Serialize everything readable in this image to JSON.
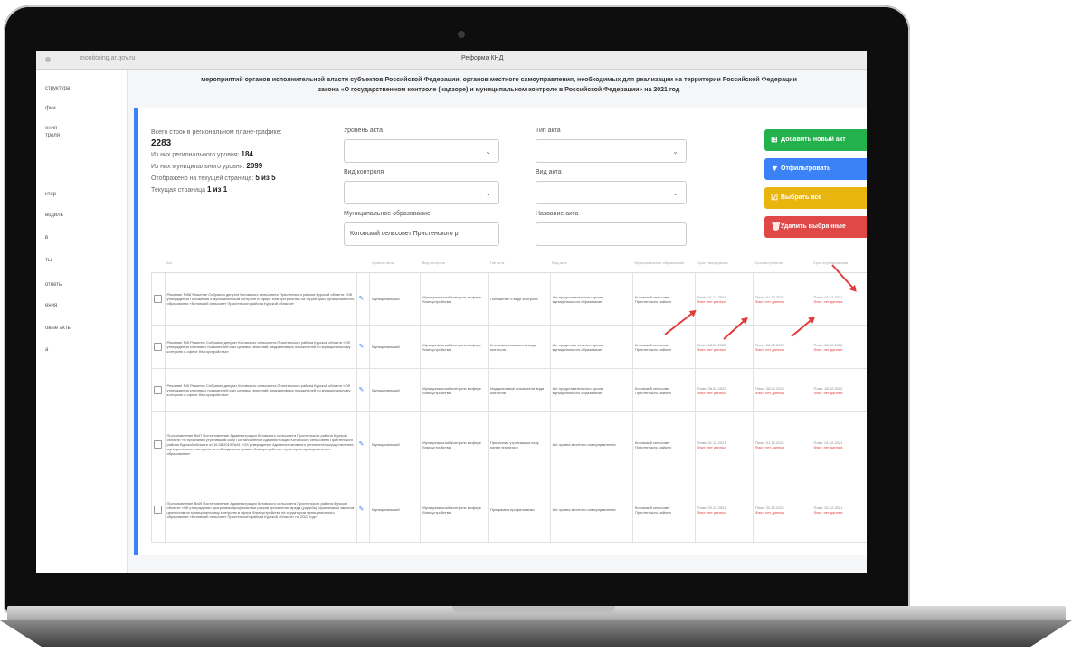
{
  "window": {
    "url": "monitoring.ar.gov.ru",
    "title": "Реформа КНД"
  },
  "sidebar": {
    "items": [
      "структура",
      "фии",
      "ения",
      "троля",
      "ктор",
      "водиль",
      "в",
      "ты",
      "ответы",
      "ения",
      "овые акты",
      "а"
    ]
  },
  "page": {
    "title_line1": "мероприятий органов исполнительной власти субъектов Российской Федерации, органов местного самоуправления, необходимых для реализации на территории Российской Федерации",
    "title_line2": "закона «О государственном контроле (надзоре) и муниципальном контроле в Российской Федерации» на 2021 год"
  },
  "stats": {
    "total_label": "Всего строк в региональном плане-графике:",
    "total_value": "2283",
    "regional_label": "Из них регионального уровня:",
    "regional_value": "184",
    "municipal_label": "Из них муниципального уровня:",
    "municipal_value": "2099",
    "shown_label": "Отображено на текущей странице:",
    "shown_value": "5 из 5",
    "page_label": "Текущая страница",
    "page_value": "1 из 1"
  },
  "filters": {
    "level_label": "Уровень акта",
    "level_value": "",
    "type_label": "Тип акта",
    "type_value": "",
    "control_label": "Вид контроля",
    "control_value": "",
    "kind_label": "Вид акта",
    "kind_value": "",
    "mo_label": "Муниципальное образование",
    "mo_value": "Котовский сельсовет Пристенского р",
    "name_label": "Название акта",
    "name_value": ""
  },
  "buttons": {
    "add": "Добавить новый акт",
    "filter": "Отфильтровать",
    "select_all": "Выбрать все",
    "delete": "Удалить выбранные"
  },
  "colors": {
    "accent": "#3b82f6",
    "add": "#22b14c",
    "filter": "#3b82f6",
    "select": "#e8b40e",
    "delete": "#e04848"
  },
  "table": {
    "headers": [
      "Акт",
      "",
      "Уровень акта",
      "Вид контроля",
      "Тип акта",
      "Вид акта",
      "Муниципальное образование",
      "Срок утверждения",
      "Срок вступления",
      "Срок опубликования"
    ],
    "rows": [
      {
        "act": "Решение №58 Решение Собрания депутат Котовского сельсовета Пристенского района Курской области «Об утверждении Положения о муниципальном контроле в сфере благоустройства на территории муниципального образования «Котовский сельсовет Пристенского района Курской области»",
        "level": "Муниципальный",
        "control": "Муниципальный контроль в сфере благоустройства",
        "type": "Положение о виде контроля",
        "kind": "Акт представительного органа муниципального образования",
        "mo": "Котовский сельсовет Пристенского района",
        "d1": "План: 01.12.2021",
        "d2": "План: 01.12.2021",
        "d3": "План: 01.12.2021",
        "f1": "Факт: нет данных",
        "f2": "Факт: нет данных",
        "f3": "Факт: нет данных"
      },
      {
        "act": "Решение №5 Решение Собрания депутат Котовского сельсовета Пристенского района Курской области «Об утверждении ключевых показателей и их целевых значений, индикативных показателей по муниципальному контролю в сфере благоустройства»",
        "level": "Муниципальный",
        "control": "Муниципальный контроль в сфере благоустройства",
        "type": "Ключевые показатели вида контроля",
        "kind": "Акт представительного органа муниципального образования",
        "mo": "Котовский сельсовет Пристенского района",
        "d1": "План: 28.02.2022",
        "d2": "План: 28.02.2022",
        "d3": "План: 28.02.2022",
        "f1": "Факт: нет данных",
        "f2": "Факт: нет данных",
        "f3": "Факт: нет данных"
      },
      {
        "act": "Решение №5 Решение Собрания депутат Котовского сельсовета Пристенского района Курской области «Об утверждении ключевых показателей и их целевых значений, индикативных показателей по муниципальному контролю в сфере благоустройства»",
        "level": "Муниципальный",
        "control": "Муниципальный контроль в сфере благоустройства",
        "type": "Индикативные показатели вида контроля",
        "kind": "Акт представительного органа муниципального образования",
        "mo": "Котовский сельсовет Пристенского района",
        "d1": "План: 28.02.2022",
        "d2": "План: 28.02.2022",
        "d3": "План: 28.02.2022",
        "f1": "Факт: нет данных",
        "f2": "Факт: нет данных",
        "f3": "Факт: нет данных"
      },
      {
        "act": "Постановление №47 Постановление Администрации Котовского сельсовета Пристенского района Курской области «О признании утратившим силу Постановления Администрации Котовского сельсовета Пристенского района Курской области от 16.08.2019 №41 «Об утверждении Административного регламента осуществления муниципального контроля за соблюдением правил благоустройства территории муниципального образования»",
        "level": "Муниципальный",
        "control": "Муниципальный контроль в сфере благоустройства",
        "type": "Признание утратившим силу ранее принятого",
        "kind": "Акт органа местного самоуправления",
        "mo": "Котовский сельсовет Пристенского района",
        "d1": "План: 01.12.2021",
        "d2": "План: 01.12.2021",
        "d3": "План: 01.12.2021",
        "f1": "Факт: нет данных",
        "f2": "Факт: нет данных",
        "f3": "Факт: нет данных"
      },
      {
        "act": "Постановление №49 Постановление Администрации Котовского сельсовета Пристенского района Курской области «Об утверждении программы профилактики рисков причинения вреда (ущерба) охраняемым законом ценностям по муниципальному контролю в сфере благоустройства на территории муниципального образования «Котовский сельсовет Пристенского района Курской области» на 2022 год»",
        "level": "Муниципальный",
        "control": "Муниципальный контроль в сфере благоустройства",
        "type": "Программа профилактики",
        "kind": "Акт органа местного самоуправления",
        "mo": "Котовский сельсовет Пристенского района",
        "d1": "План: 20.12.2021",
        "d2": "План: 20.12.2021",
        "d3": "План: 20.12.2021",
        "f1": "Факт: нет данных",
        "f2": "Факт: нет данных",
        "f3": "Факт: нет данных"
      }
    ]
  }
}
